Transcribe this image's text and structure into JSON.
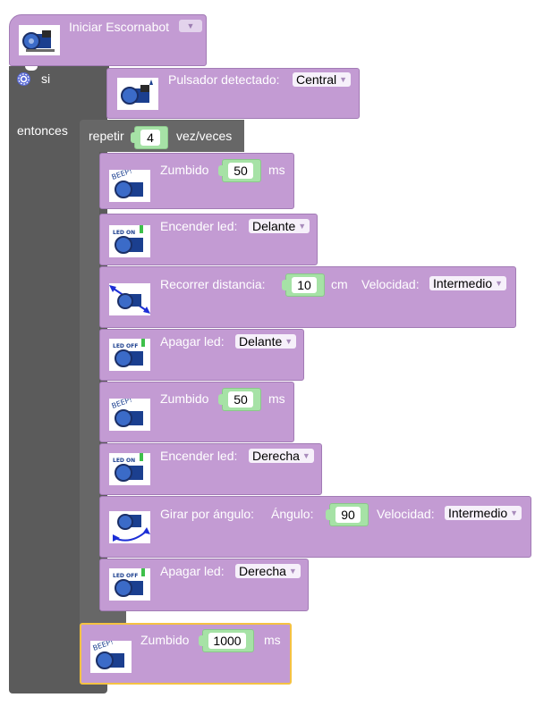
{
  "hat_block": {
    "title": "Iniciar Escornabot"
  },
  "if_block": {
    "si_label": "si",
    "entonces_label": "entonces"
  },
  "condition": {
    "label": "Pulsador detectado:",
    "value": "Central"
  },
  "repeat": {
    "label": "repetir",
    "count": "4",
    "suffix": "vez/veces"
  },
  "inner": [
    {
      "label": "Zumbido",
      "value": "50",
      "unit": "ms"
    },
    {
      "label": "Encender led:",
      "value": "Delante"
    },
    {
      "label": "Recorrer distancia:",
      "value": "10",
      "unit": "cm",
      "speed_label": "Velocidad:",
      "speed": "Intermedio"
    },
    {
      "label": "Apagar led:",
      "value": "Delante"
    },
    {
      "label": "Zumbido",
      "value": "50",
      "unit": "ms"
    },
    {
      "label": "Encender led:",
      "value": "Derecha"
    },
    {
      "label": "Girar por ángulo:",
      "angle_label": "Ángulo:",
      "value": "90",
      "speed_label": "Velocidad:",
      "speed": "Intermedio"
    },
    {
      "label": "Apagar led:",
      "value": "Derecha"
    }
  ],
  "final_beep": {
    "label": "Zumbido",
    "value": "1000",
    "unit": "ms"
  },
  "icon_text": {
    "beep": "BEEP!",
    "led_on": "LED ON",
    "led_off": "LED OFF"
  },
  "colors": {
    "block": "#c39bd3",
    "control": "#5b5b5b",
    "number": "#a6e2a6",
    "selected": "#f5c242"
  }
}
